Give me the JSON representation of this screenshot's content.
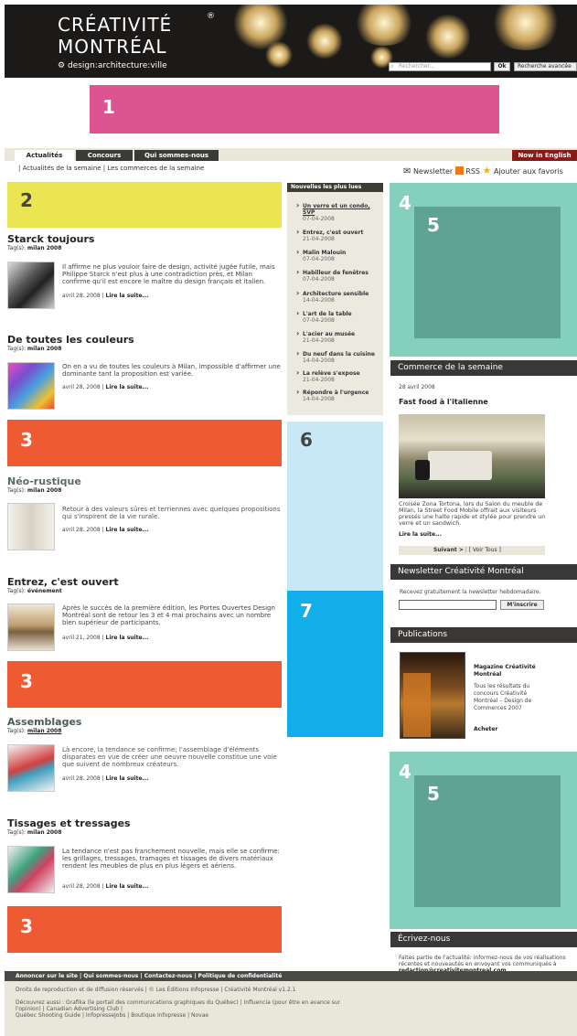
{
  "header": {
    "logo_line1": "CRÉATIVITÉ",
    "logo_line2": "MONTRÉAL",
    "logo_sub": "design:architecture:ville",
    "logo_reg": "®",
    "search_placeholder": "Rechercher...",
    "ok_label": "Ok",
    "advanced_label": "Recherche avancée"
  },
  "ads": {
    "banner_top": "1",
    "main_top": "2",
    "slot3": "3",
    "right4": "4",
    "right5": "5",
    "mid6": "6",
    "mid7": "7"
  },
  "nav": {
    "tabs": [
      "Actualités",
      "Concours",
      "Qui sommes-nous"
    ],
    "english": "Now in English",
    "sub": "|  Actualités de la semaine  |  Les commerces de la semaine"
  },
  "tools": {
    "newsletter": "Newsletter",
    "rss": "RSS",
    "favoris": "Ajouter aux favoris"
  },
  "articles": [
    {
      "title": "Starck toujours",
      "tag": "milan 2008",
      "text": "Il affirme ne plus vouloir faire de design, activité jugée futile, mais Philippe Starck n'est plus à une contradiction près, et Milan confirme qu'il est encore le maître du design français et italien.",
      "date": "avril 28, 2008"
    },
    {
      "title": "De toutes les couleurs",
      "tag": "milan 2008",
      "text": "On en a vu de toutes les couleurs à Milan, impossible d'affirmer une dominante tant la proposition est variée.",
      "date": "avril 28, 2008"
    },
    {
      "title": "Néo-rustique",
      "tag": "milan 2008",
      "text": "Retour à des valeurs sûres et terriennes avec quelques propositions qui s'inspirent de la vie rurale.",
      "date": "avril 28, 2008"
    },
    {
      "title": "Entrez, c'est ouvert",
      "tag": "événement",
      "text": "Après le succès de la première édition, les Portes Ouvertes Design Montréal sont de retour les 3 et 4 mai prochains avec un nombre bien supérieur de participants.",
      "date": "avril 21, 2008"
    },
    {
      "title": "Assemblages",
      "tag": "milan 2008",
      "text": "Là encore, la tendance se confirme; l'assemblage d'éléments disparates en vue de créer une oeuvre nouvelle constitue une voie que suivent de nombreux créateurs.",
      "date": "avril 28, 2008"
    },
    {
      "title": "Tissages et tressages",
      "tag": "milan 2008",
      "text": "La tendance n'est pas franchement nouvelle, mais elle se confirme: les grillages, tressages, tramages et tissages de divers matériaux rendent les meubles de plus en plus légers et aériens.",
      "date": "avril 28, 2008"
    }
  ],
  "read_more": "Lire la suite...",
  "tag_label": "Tag(s):",
  "news": {
    "heading": "Nouvelles les plus lues",
    "items": [
      {
        "title": "Un verre et un condo, SVP",
        "date": "07-04-2008"
      },
      {
        "title": "Entrez, c'est ouvert",
        "date": "21-04-2008"
      },
      {
        "title": "Malin Malouin",
        "date": "07-04-2008"
      },
      {
        "title": "Habilleur de fenêtres",
        "date": "07-04-2008"
      },
      {
        "title": "Architecture sensible",
        "date": "14-04-2008"
      },
      {
        "title": "L'art de la table",
        "date": "07-04-2008"
      },
      {
        "title": "L'acier au musée",
        "date": "21-04-2008"
      },
      {
        "title": "Du neuf dans la cuisine",
        "date": "14-04-2008"
      },
      {
        "title": "La relève s'expose",
        "date": "21-04-2008"
      },
      {
        "title": "Répondre à l'urgence",
        "date": "14-04-2008"
      }
    ]
  },
  "commerce": {
    "heading": "Commerce de la semaine",
    "date": "28 avril 2008",
    "title": "Fast food à l'italienne",
    "text": "Croisée Zona Tortona, lors du Salon du meuble de Milan, la Street Food Mobile offrait aux visiteurs pressés une halte rapide et stylée pour prendre un verre et un sandwich.",
    "more": "Lire la suite...",
    "next": "Suivant >",
    "all": "[ Voir Tous ]"
  },
  "newsletter": {
    "heading": "Newsletter Créativité Montréal",
    "text": "Recevez gratuitement la newsletter hebdomadaire.",
    "button": "M'inscrire"
  },
  "publications": {
    "heading": "Publications",
    "title": "Magazine Créativité Montréal",
    "text": "Tous les résultats du concours Créativité Montréal – Design de Commerces 2007",
    "buy": "Acheter"
  },
  "contact": {
    "heading": "Écrivez-nous",
    "text": "Faites partie de l'actualité: informez-nous de vos réalisations récentes et nouveautés en envoyant vos communiqués à",
    "email": "redaction@creativitemontreal.com"
  },
  "footer": {
    "links": "Annoncer sur le site  |  Qui sommes-nous  |  Contactez-nous  |  Politique de confidentialité",
    "copy": "Droits de reproduction et de diffusion réservés | © Les Éditions Infopresse | Créativité Montréal v1.2.1",
    "discover1": "Découvrez aussi : Grafika (le portail des communications graphiques du Québec) | Influencia (pour être en avance sur",
    "discover2": "l'opinion) | Canadian Advertising Club |",
    "discover3": "Québec Shooting Guide | InfopresseJobs | Boutique Infopresse | Novae"
  },
  "colors": {
    "pink": "#dc5590",
    "yellow": "#ece552",
    "orange": "#ee5b33",
    "teal_light": "#85cfbd",
    "teal_dark": "#5ea393",
    "sky": "#c9e8f6",
    "blue": "#11aeea",
    "tab_dark": "#3a3a36",
    "english_red": "#8a1a16"
  }
}
